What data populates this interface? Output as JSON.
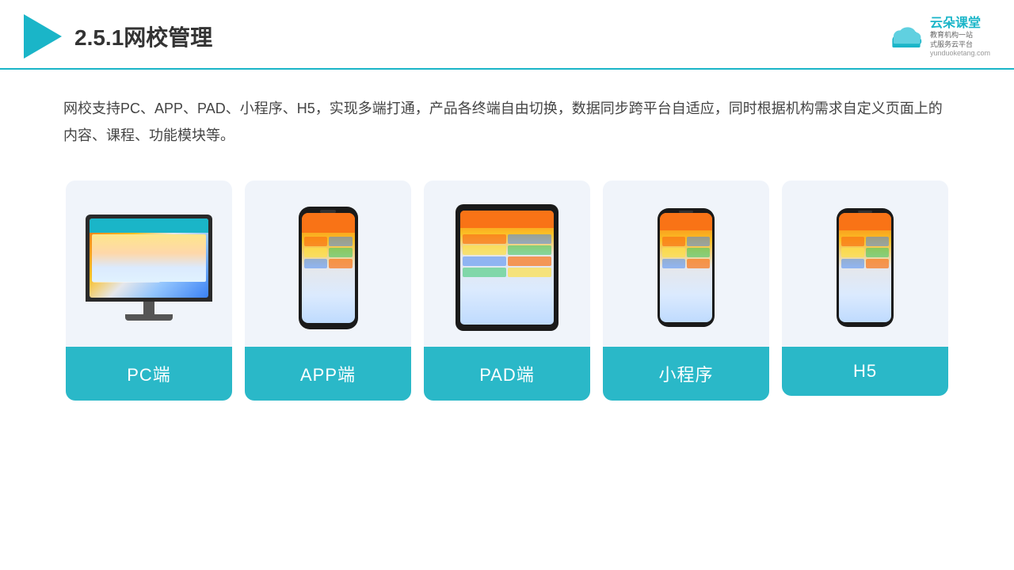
{
  "header": {
    "title": "2.5.1网校管理",
    "brand_name": "云朵课堂",
    "brand_sub1": "教育机构一站",
    "brand_sub2": "式服务云平台",
    "brand_url": "yunduoketang.com"
  },
  "description": {
    "text": "网校支持PC、APP、PAD、小程序、H5，实现多端打通，产品各终端自由切换，数据同步跨平台自适应，同时根据机构需求自定义页面上的内容、课程、功能模块等。"
  },
  "cards": [
    {
      "label": "PC端",
      "type": "pc"
    },
    {
      "label": "APP端",
      "type": "phone"
    },
    {
      "label": "PAD端",
      "type": "tablet"
    },
    {
      "label": "小程序",
      "type": "smartphone"
    },
    {
      "label": "H5",
      "type": "smartphone2"
    }
  ]
}
